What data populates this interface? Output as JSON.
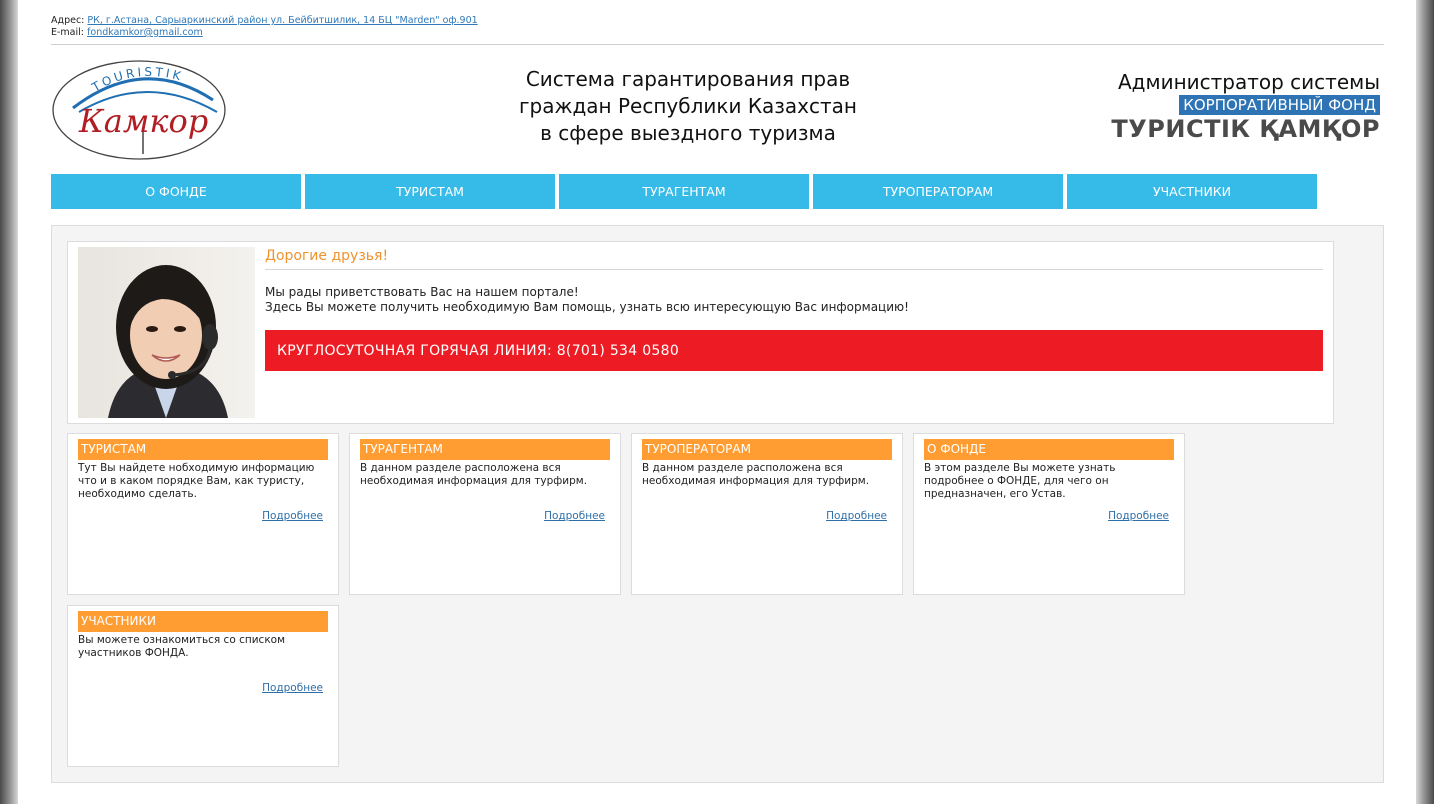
{
  "contact": {
    "address_label": "Адрес:",
    "address_value": "РК, г.Астана, Сарыаркинский район ул. Бейбитшилик, 14 БЦ \"Marden\" оф.901",
    "email_label": "E-mail:",
    "email_value": "fondkamkor@gmail.com"
  },
  "logo": {
    "top_text": "TOURISTIK",
    "main_text": "Камкор"
  },
  "header": {
    "title_lines": [
      "Система гарантирования прав",
      "граждан Республики Казахстан",
      "в сфере выездного туризма"
    ],
    "admin_label": "Администратор системы",
    "admin_fund": "КОРПОРАТИВНЫЙ ФОНД",
    "admin_brand": "ТУРИСТІК ҚАМҚОР"
  },
  "nav": [
    "О ФОНДЕ",
    "ТУРИСТАМ",
    "ТУРАГЕНТАМ",
    "ТУРОПЕРАТОРАМ",
    "УЧАСТНИКИ"
  ],
  "welcome": {
    "title": "Дорогие друзья!",
    "line1": "Мы рады приветствовать Вас на нашем портале!",
    "line2": "Здесь Вы можете получить необходимую Вам помощь, узнать всю интересующую Вас информацию!",
    "hotline": "КРУГЛОСУТОЧНАЯ ГОРЯЧАЯ ЛИНИЯ: 8(701) 534 0580"
  },
  "cards": [
    {
      "title": "ТУРИСТАМ",
      "text": "Тут Вы найдете нобходимую информацию что и в каком порядке Вам, как туристу, необходимо сделать.",
      "more": "Подробнее"
    },
    {
      "title": "ТУРАГЕНТАМ",
      "text": "В данном разделе расположена вся необходимая информация для турфирм.",
      "more": "Подробнее"
    },
    {
      "title": "ТУРОПЕРАТОРАМ",
      "text": "В данном разделе расположена вся необходимая информация для турфирм.",
      "more": "Подробнее"
    },
    {
      "title": "О ФОНДЕ",
      "text": "В этом разделе Вы можете узнать подробнее о ФОНДЕ, для чего он предназначен, его Устав.",
      "more": "Подробнее"
    },
    {
      "title": "УЧАСТНИКИ",
      "text": "Вы можете ознакомиться со списком участников ФОНДА.",
      "more": "Подробнее"
    }
  ],
  "colors": {
    "nav": "#36bbe8",
    "card_header": "#ff9d33",
    "hotline": "#ed1c24",
    "welcome_title": "#f0922e",
    "fund_badge": "#2e74b5"
  }
}
